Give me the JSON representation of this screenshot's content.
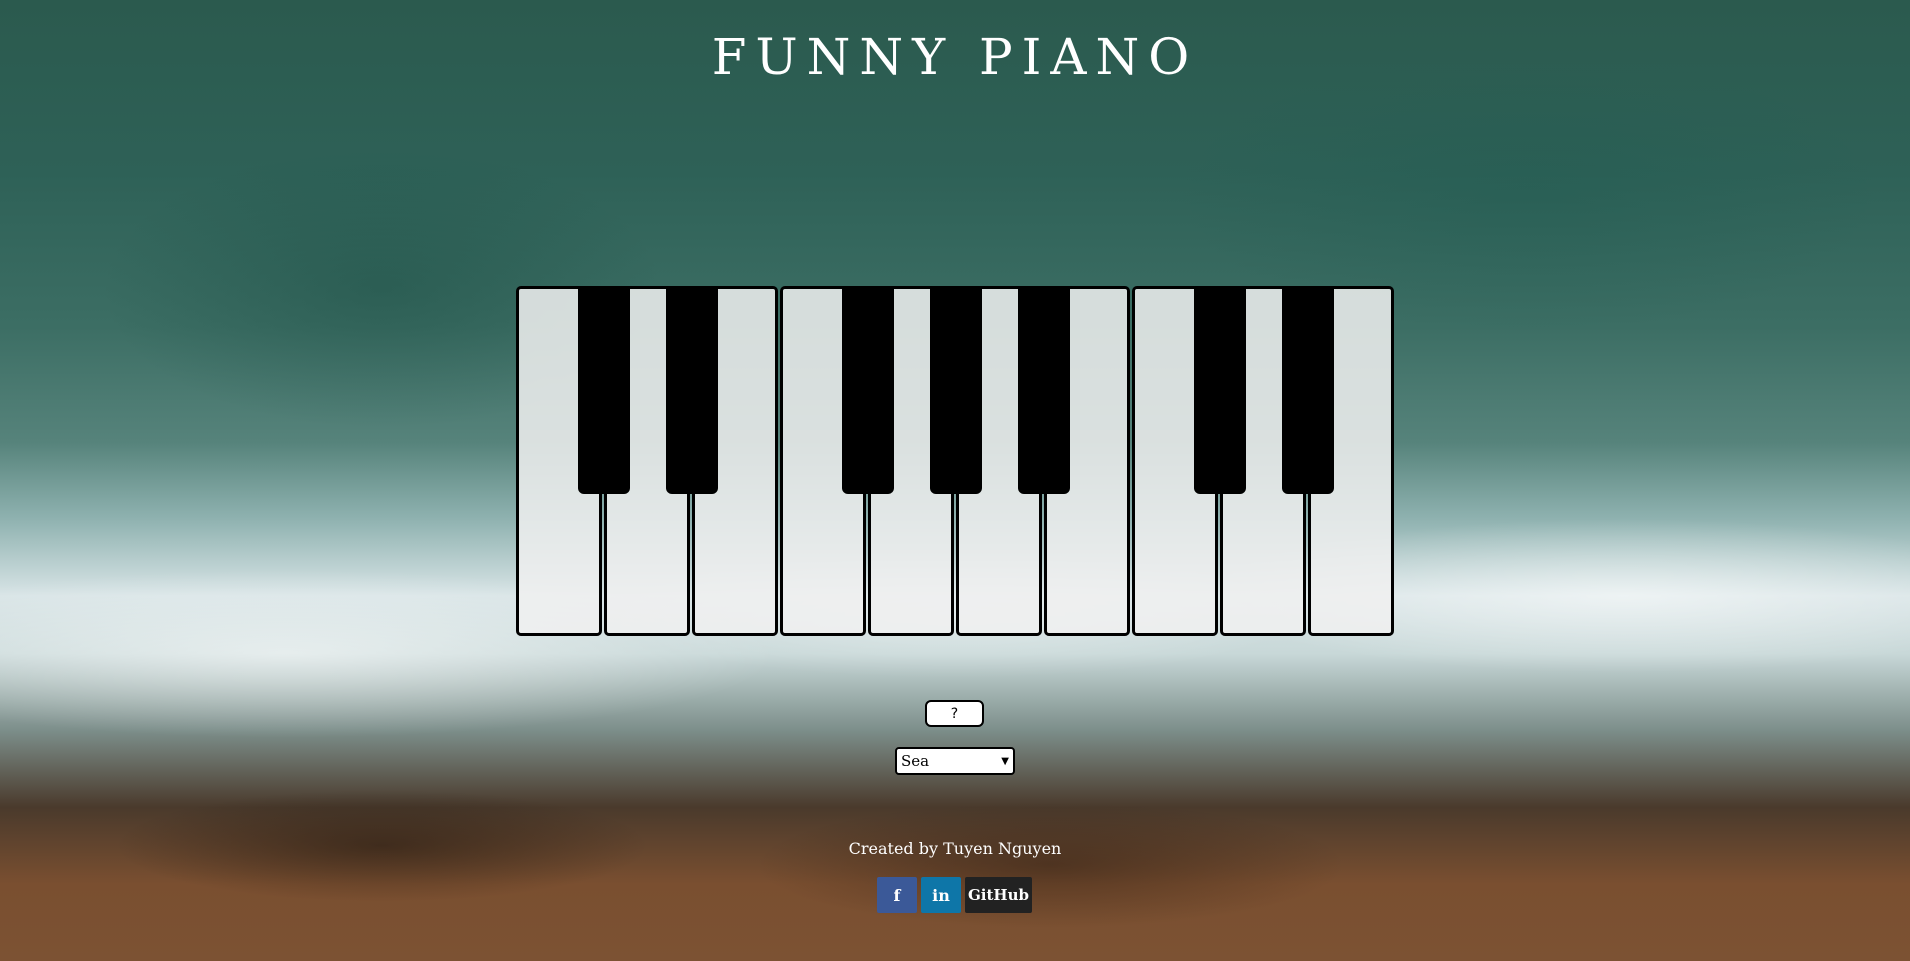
{
  "header": {
    "title": "FUNNY PIANO"
  },
  "controls": {
    "help_label": "?",
    "theme_selected": "Sea"
  },
  "footer": {
    "credit": "Created by Tuyen Nguyen",
    "socials": {
      "facebook_label": "f",
      "linkedin_label": "in",
      "github_label": "GitHub"
    }
  },
  "colors": {
    "facebook": "#3b5998",
    "linkedin": "#0e76a8",
    "github": "#222222",
    "white_key": "#f0f0f0",
    "black_key": "#000000"
  },
  "icons": [
    "facebook-icon",
    "linkedin-icon",
    "chevron-down-icon"
  ]
}
